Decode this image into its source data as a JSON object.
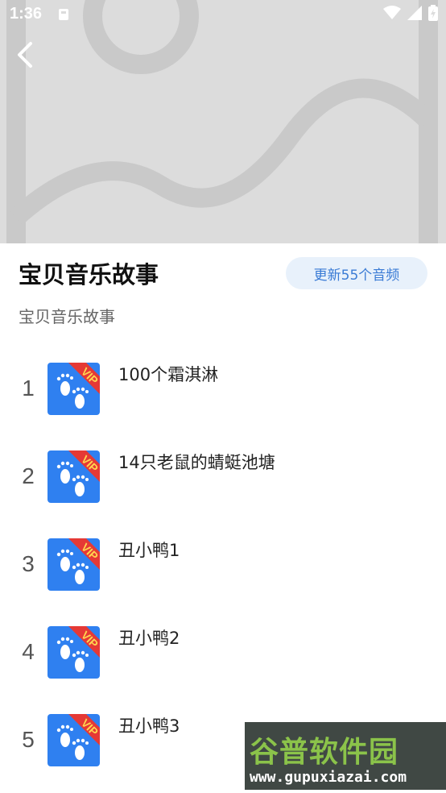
{
  "status_bar": {
    "time": "1:36"
  },
  "album": {
    "title": "宝贝音乐故事",
    "subtitle": "宝贝音乐故事",
    "update_label": "更新55个音频"
  },
  "tracks": [
    {
      "number": "1",
      "title": "100个霜淇淋",
      "badge": "VIP"
    },
    {
      "number": "2",
      "title": "14只老鼠的蜻蜓池塘",
      "badge": "VIP"
    },
    {
      "number": "3",
      "title": "丑小鸭1",
      "badge": "VIP"
    },
    {
      "number": "4",
      "title": "丑小鸭2",
      "badge": "VIP"
    },
    {
      "number": "5",
      "title": "丑小鸭3",
      "badge": "VIP"
    }
  ],
  "watermark": {
    "line1": "谷普软件园",
    "line2": "www.gupuxiazai.com"
  },
  "colors": {
    "accent": "#3a7bd5",
    "cover_blue": "#2f80f0",
    "vip_red": "#e53935",
    "vip_yellow": "#ffd54f"
  }
}
